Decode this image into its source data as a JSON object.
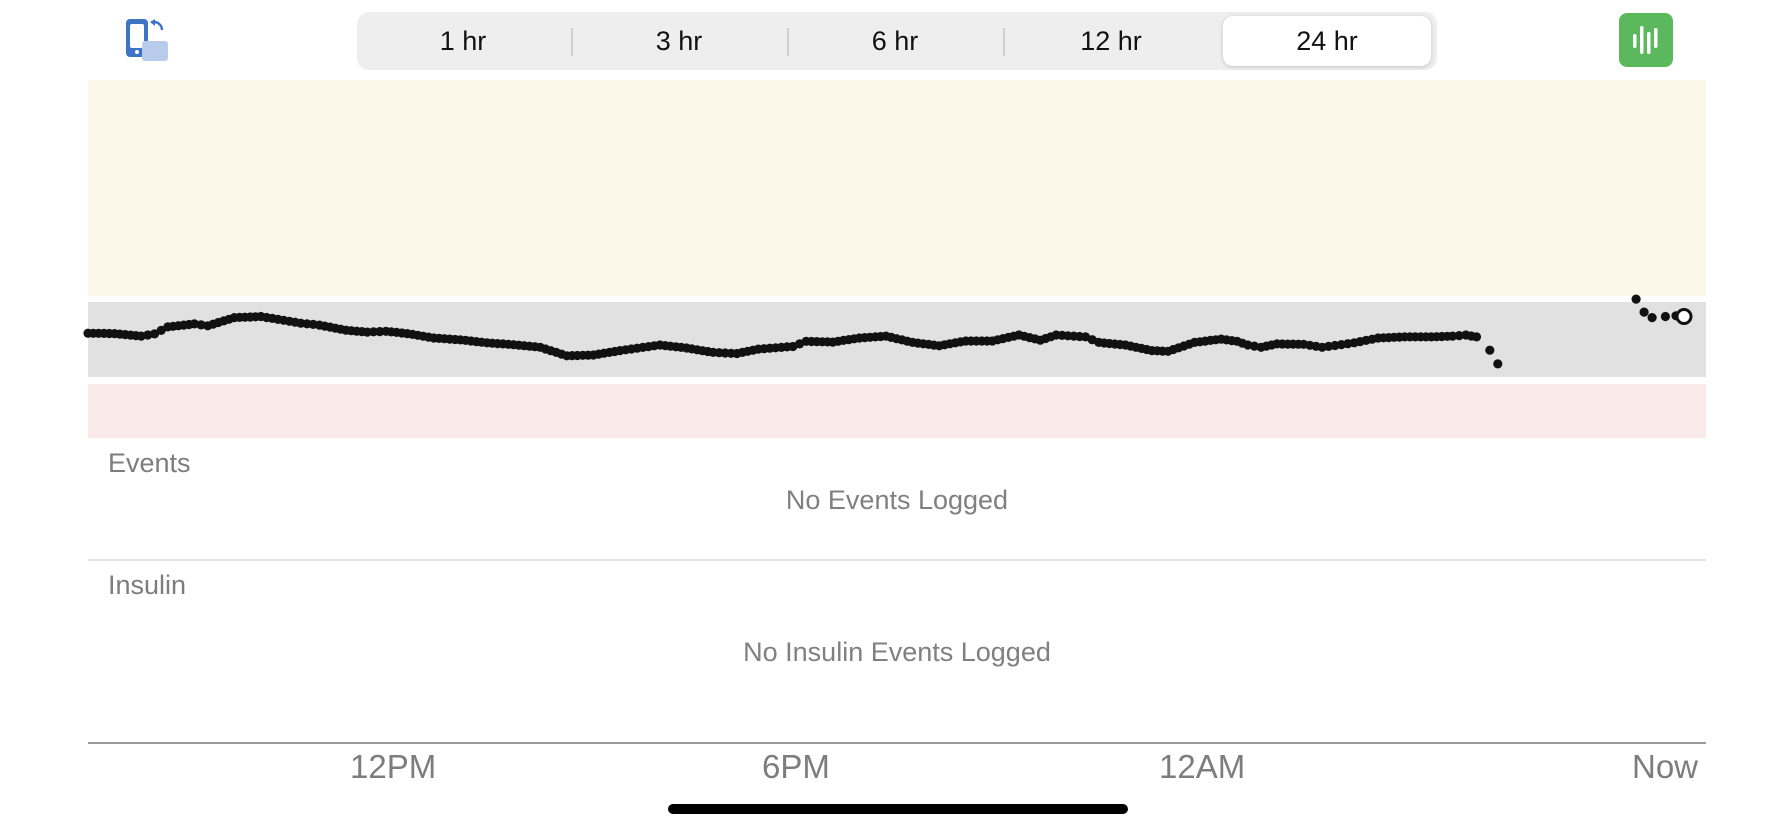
{
  "header": {
    "time_ranges": [
      {
        "label": "1 hr",
        "selected": false
      },
      {
        "label": "3 hr",
        "selected": false
      },
      {
        "label": "6 hr",
        "selected": false
      },
      {
        "label": "12 hr",
        "selected": false
      },
      {
        "label": "24 hr",
        "selected": true
      }
    ],
    "rotate_icon": "phone-rotate-icon",
    "chart_icon": "bar-chart-icon"
  },
  "colors": {
    "high_zone": "#fbf8ea",
    "target_zone": "#e1e1e1",
    "low_zone": "#faeaea",
    "points": "#111111",
    "accent_green": "#5cb85c",
    "icon_blue": "#3d74c5"
  },
  "chart_data": {
    "type": "scatter",
    "y_scale": "relative",
    "zones": [
      "high",
      "target",
      "low"
    ],
    "x_ticks": [
      "12PM",
      "6PM",
      "12AM",
      "Now"
    ],
    "series": [
      {
        "values": [
          [
            0.0,
            0.13
          ],
          [
            1.0,
            0.12
          ],
          [
            2.0,
            0.05
          ],
          [
            2.5,
            0.11
          ],
          [
            3.0,
            0.3
          ],
          [
            4.0,
            0.38
          ],
          [
            4.5,
            0.33
          ],
          [
            5.5,
            0.55
          ],
          [
            6.5,
            0.58
          ],
          [
            8.0,
            0.4
          ],
          [
            8.7,
            0.35
          ],
          [
            9.7,
            0.21
          ],
          [
            10.5,
            0.16
          ],
          [
            11.2,
            0.18
          ],
          [
            12.0,
            0.12
          ],
          [
            13.0,
            0.0
          ],
          [
            14.0,
            -0.05
          ],
          [
            15.0,
            -0.13
          ],
          [
            16.0,
            -0.18
          ],
          [
            17.0,
            -0.25
          ],
          [
            18.0,
            -0.48
          ],
          [
            19.0,
            -0.46
          ],
          [
            20.0,
            -0.34
          ],
          [
            21.5,
            -0.19
          ],
          [
            22.5,
            -0.27
          ],
          [
            23.5,
            -0.39
          ],
          [
            24.4,
            -0.42
          ],
          [
            25.2,
            -0.3
          ],
          [
            26.5,
            -0.23
          ],
          [
            27.0,
            -0.09
          ],
          [
            28.0,
            -0.11
          ],
          [
            29.0,
            0.0
          ],
          [
            30.0,
            0.05
          ],
          [
            31.0,
            -0.12
          ],
          [
            32.0,
            -0.21
          ],
          [
            33.0,
            -0.08
          ],
          [
            34.0,
            -0.08
          ],
          [
            35.0,
            0.08
          ],
          [
            35.8,
            -0.06
          ],
          [
            36.4,
            0.08
          ],
          [
            37.5,
            0.03
          ],
          [
            38.0,
            -0.12
          ],
          [
            39.0,
            -0.19
          ],
          [
            40.0,
            -0.34
          ],
          [
            40.6,
            -0.36
          ],
          [
            41.6,
            -0.12
          ],
          [
            42.6,
            -0.03
          ],
          [
            43.2,
            -0.09
          ],
          [
            43.6,
            -0.19
          ],
          [
            44.1,
            -0.25
          ],
          [
            44.7,
            -0.16
          ],
          [
            45.7,
            -0.17
          ],
          [
            46.4,
            -0.25
          ],
          [
            47.6,
            -0.13
          ],
          [
            48.5,
            0.0
          ],
          [
            49.5,
            0.03
          ],
          [
            50.5,
            0.03
          ],
          [
            51.3,
            0.05
          ],
          [
            51.8,
            0.08
          ],
          [
            52.2,
            0.03
          ],
          [
            52.4,
            -0.1
          ],
          [
            52.7,
            -0.33
          ],
          [
            53.0,
            -0.7
          ]
        ]
      },
      {
        "values": [
          [
            58.2,
            1.05
          ],
          [
            58.5,
            0.7
          ],
          [
            58.8,
            0.55
          ],
          [
            59.3,
            0.58
          ],
          [
            59.7,
            0.6
          ]
        ]
      }
    ],
    "current_reading": [
      60.0,
      0.58
    ]
  },
  "events": {
    "title": "Events",
    "empty_message": "No Events Logged"
  },
  "insulin": {
    "title": "Insulin",
    "empty_message": "No Insulin Events Logged"
  }
}
